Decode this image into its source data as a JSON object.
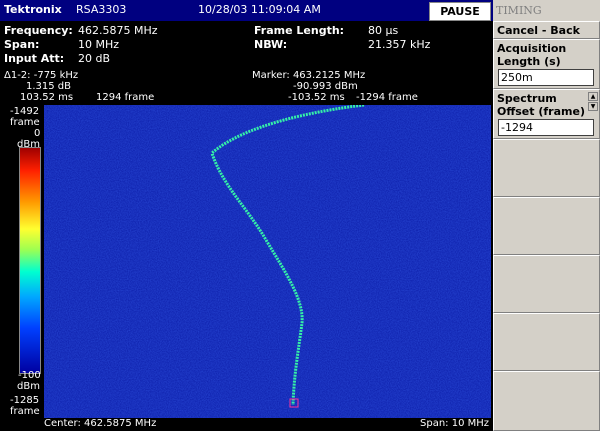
{
  "title_bar": {
    "brand": "Tektronix",
    "model": "RSA3303",
    "datetime": "10/28/03 11:09:04 AM",
    "pause_label": "PAUSE"
  },
  "settings": {
    "frequency_label": "Frequency:",
    "frequency_value": "462.5875 MHz",
    "span_label": "Span:",
    "span_value": "10 MHz",
    "input_att_label": "Input Att:",
    "input_att_value": "20 dB",
    "frame_length_label": "Frame Length:",
    "frame_length_value": "80 µs",
    "nbw_label": "NBW:",
    "nbw_value": "21.357 kHz"
  },
  "delta_marker": {
    "freq": "Δ1-2: -775 kHz",
    "level": "1.315 dB",
    "time": "103.52 ms",
    "frame": "1294 frame"
  },
  "marker": {
    "freq": "Marker: 463.2125 MHz",
    "level": "-90.993 dBm",
    "time": "-103.52 ms",
    "frame": "-1294 frame"
  },
  "colorbar": {
    "top_frame": "-1492",
    "top_frame_unit": "frame",
    "max_level": "0",
    "max_unit": "dBm",
    "min_level": "-100",
    "min_unit": "dBm",
    "bottom_frame": "-1285",
    "bottom_frame_unit": "frame"
  },
  "bottom": {
    "center": "Center: 462.5875 MHz",
    "span": "Span: 10 MHz"
  },
  "sidebar": {
    "title": "TIMING",
    "cancel_back": "Cancel - Back",
    "acq_length_label": "Acquisition Length (s)",
    "acq_length_value": "250m",
    "spectrum_offset_label": "Spectrum Offset (frame)",
    "spectrum_offset_value": "-1294"
  },
  "colors": {
    "title_bar": "#000080",
    "plot_bg": "#0a1aa6",
    "trace": "#35f0a8",
    "sidebar": "#d4d0c8",
    "marker_box": "#ff3399"
  }
}
